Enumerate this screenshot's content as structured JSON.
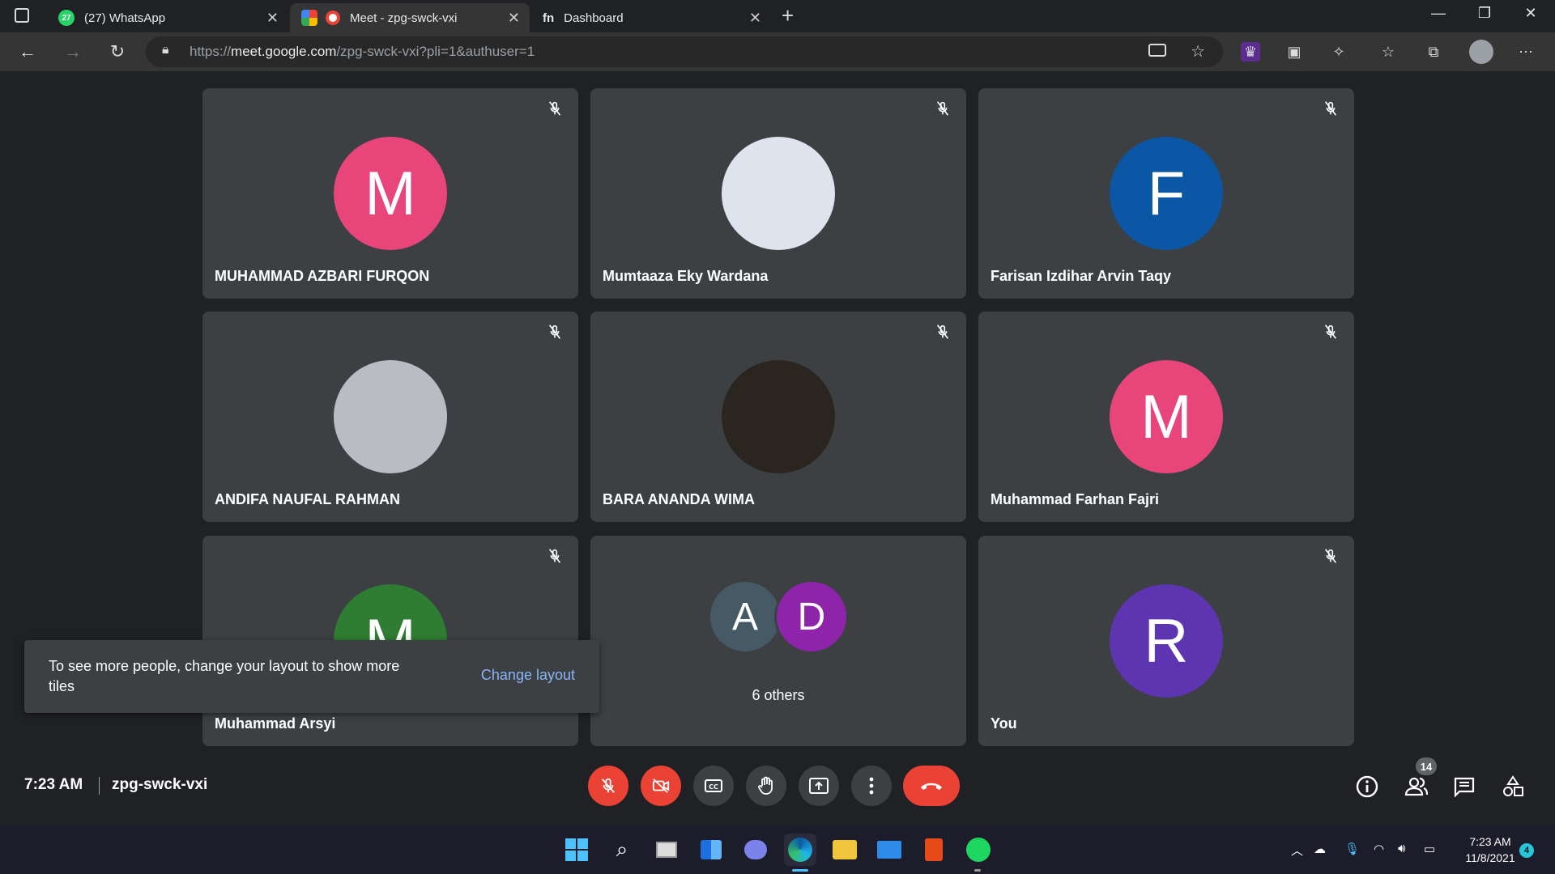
{
  "browser": {
    "tabs": [
      {
        "title": "(27) WhatsApp",
        "badge": "27"
      },
      {
        "title": "Meet - zpg-swck-vxi"
      },
      {
        "title": "Dashboard"
      }
    ],
    "url_prefix": "https://",
    "url_domain": "meet.google.com",
    "url_path": "/zpg-swck-vxi?pli=1&authuser=1",
    "colors": {
      "background": "#202124",
      "toolbar": "#353535"
    }
  },
  "meet": {
    "tiles": [
      {
        "name": "MUHAMMAD AZBARI FURQON",
        "initial": "M",
        "color": "#e8457b",
        "type": "initial"
      },
      {
        "name": "Mumtaaza Eky Wardana",
        "initial": "",
        "color": "#dfe3ee",
        "type": "photo"
      },
      {
        "name": "Farisan Izdihar Arvin Taqy",
        "initial": "F",
        "color": "#0b57a5",
        "type": "initial"
      },
      {
        "name": "ANDIFA NAUFAL RAHMAN",
        "initial": "",
        "color": "#b9bcc3",
        "type": "photo"
      },
      {
        "name": "BARA ANANDA WIMA",
        "initial": "",
        "color": "#2b2520",
        "type": "photo"
      },
      {
        "name": "Muhammad Farhan Fajri",
        "initial": "M",
        "color": "#e8457b",
        "type": "initial"
      },
      {
        "name": "Muhammad Arsyi",
        "initial": "M",
        "color": "#2e7d32",
        "type": "initial"
      },
      {
        "name": "6 others",
        "initials": [
          "A",
          "D"
        ],
        "colors": [
          "#455a64",
          "#8e24aa"
        ],
        "type": "others"
      },
      {
        "name": "You",
        "initial": "R",
        "color": "#5e35b1",
        "type": "initial"
      }
    ],
    "toast": {
      "message": "To see more people, change your layout to show more tiles",
      "action": "Change layout"
    },
    "time": "7:23 AM",
    "meeting_code": "zpg-swck-vxi",
    "participants_count": "14",
    "controls": [
      "mic-off-icon",
      "camera-off-icon",
      "captions-icon",
      "raise-hand-icon",
      "present-icon",
      "more-options-icon",
      "end-call-icon"
    ]
  },
  "taskbar": {
    "clock_time": "7:23 AM",
    "clock_date": "11/8/2021",
    "notifications": "4"
  }
}
